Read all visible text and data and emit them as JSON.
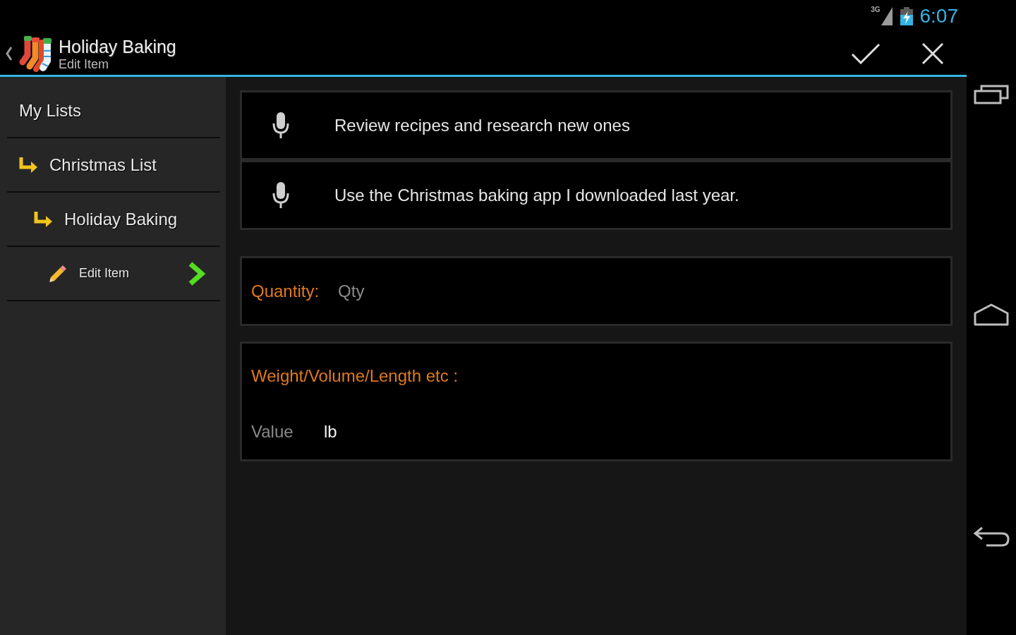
{
  "status_bar": {
    "network": "3G",
    "time": "6:07"
  },
  "action_bar": {
    "title": "Holiday Baking",
    "subtitle": "Edit Item"
  },
  "sidebar": {
    "items": [
      {
        "label": "My Lists",
        "kind": "root",
        "selected": false,
        "children": [
          {
            "label": "Christmas List",
            "kind": "list",
            "selected": false,
            "children": [
              {
                "label": "Holiday Baking",
                "kind": "list",
                "selected": false,
                "children": [
                  {
                    "label": "Edit Item",
                    "kind": "edit",
                    "selected": true
                  }
                ]
              }
            ]
          }
        ]
      }
    ]
  },
  "form": {
    "notes": [
      {
        "value": "Review recipes and research new ones"
      },
      {
        "value": "Use the Christmas baking app I downloaded last year."
      }
    ],
    "quantity": {
      "label": "Quantity:",
      "placeholder": "Qty"
    },
    "measure": {
      "label": "Weight/Volume/Length etc :",
      "placeholder": "Value",
      "unit": "lb"
    }
  }
}
